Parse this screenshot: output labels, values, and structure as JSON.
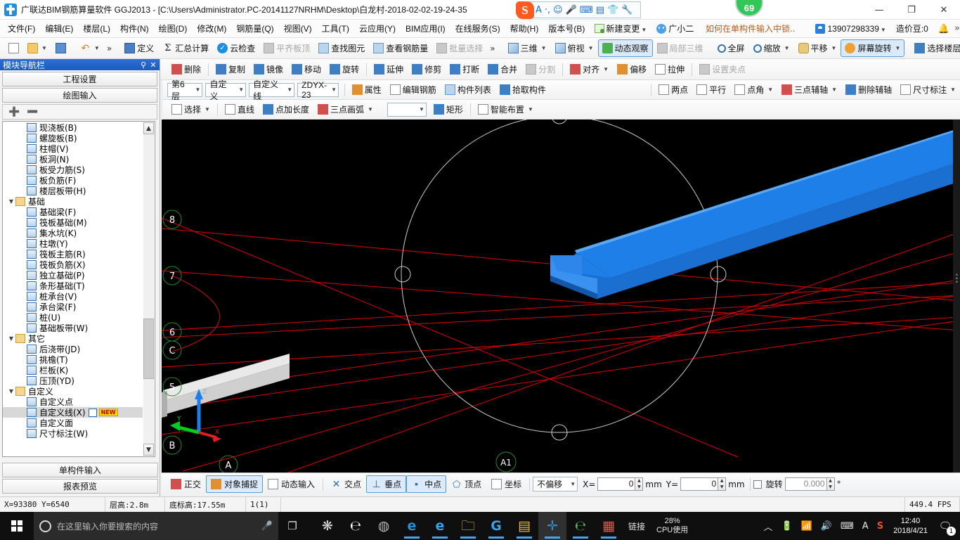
{
  "titlebar": {
    "title": "广联达BIM钢筋算量软件 GGJ2013 - [C:\\Users\\Administrator.PC-20141127NRHM\\Desktop\\白龙村-2018-02-02-19-24-35",
    "logo_name": "ggj-logo",
    "sogou_icons": [
      "sogou-s-icon",
      "A",
      "·,",
      "☺",
      "🎤",
      "⌨",
      "📇",
      "👕",
      "🔧"
    ],
    "minimize": "—",
    "maximize": "❐",
    "close": "✕",
    "badge": "69"
  },
  "menubar": {
    "items": [
      "文件(F)",
      "编辑(E)",
      "楼层(L)",
      "构件(N)",
      "绘图(D)",
      "修改(M)",
      "钢筋量(Q)",
      "视图(V)",
      "工具(T)",
      "云应用(Y)",
      "BIM应用(I)",
      "在线服务(S)",
      "帮助(H)",
      "版本号(B)"
    ],
    "new_change": "新建变更",
    "assistant": "广小二",
    "tip": "如何在单构件输入中锁..",
    "phone": "13907298339",
    "beans": "造价豆:0",
    "more": "»"
  },
  "toolbar1": {
    "left": [
      {
        "label": "",
        "icon": "new-file-icon"
      },
      {
        "label": "",
        "icon": "open-folder-icon"
      },
      {
        "label": "",
        "icon": "save-icon"
      },
      {
        "label": "",
        "icon": "undo-icon"
      }
    ],
    "chev": "»",
    "items": [
      {
        "label": "定义",
        "icon": "define-icon",
        "state": "normal"
      },
      {
        "label": "汇总计算",
        "icon": "sigma-icon",
        "state": "normal"
      },
      {
        "label": "云检查",
        "icon": "cloud-check-icon",
        "state": "normal"
      },
      {
        "label": "平齐板顶",
        "icon": "align-slab-icon",
        "state": "disabled"
      },
      {
        "label": "查找图元",
        "icon": "find-element-icon",
        "state": "normal"
      },
      {
        "label": "查看钢筋量",
        "icon": "view-rebar-icon",
        "state": "normal"
      },
      {
        "label": "批量选择",
        "icon": "batch-select-icon",
        "state": "disabled"
      }
    ],
    "right_chev": "»",
    "view_items": [
      {
        "label": "三维",
        "icon": "cube-icon",
        "state": "normal",
        "caret": true
      },
      {
        "label": "俯视",
        "icon": "topview-icon",
        "state": "normal",
        "caret": true
      },
      {
        "label": "动态观察",
        "icon": "orbit-icon",
        "state": "active"
      },
      {
        "label": "局部三维",
        "icon": "partial3d-icon",
        "state": "disabled"
      },
      {
        "label": "全屏",
        "icon": "fullscreen-icon",
        "state": "normal"
      },
      {
        "label": "缩放",
        "icon": "zoom-icon",
        "state": "normal",
        "caret": true
      },
      {
        "label": "平移",
        "icon": "pan-icon",
        "state": "normal",
        "caret": true
      },
      {
        "label": "屏幕旋转",
        "icon": "screen-rotate-icon",
        "state": "active",
        "caret": true
      },
      {
        "label": "选择楼层",
        "icon": "select-floor-icon",
        "state": "normal"
      }
    ],
    "far_chev": "»"
  },
  "toolbar2": {
    "items": [
      {
        "label": "删除",
        "icon": "delete-icon",
        "state": "normal"
      },
      {
        "label": "复制",
        "icon": "copy-icon",
        "state": "normal"
      },
      {
        "label": "镜像",
        "icon": "mirror-icon",
        "state": "normal"
      },
      {
        "label": "移动",
        "icon": "move-icon",
        "state": "normal"
      },
      {
        "label": "旋转",
        "icon": "rotate-icon",
        "state": "normal"
      },
      {
        "label": "延伸",
        "icon": "extend-icon",
        "state": "normal"
      },
      {
        "label": "修剪",
        "icon": "trim-icon",
        "state": "normal"
      },
      {
        "label": "打断",
        "icon": "break-icon",
        "state": "normal"
      },
      {
        "label": "合并",
        "icon": "merge-icon",
        "state": "normal"
      },
      {
        "label": "分割",
        "icon": "split-icon",
        "state": "disabled"
      },
      {
        "label": "对齐",
        "icon": "align-icon",
        "state": "normal",
        "caret": true
      },
      {
        "label": "偏移",
        "icon": "offset-icon",
        "state": "normal"
      },
      {
        "label": "拉伸",
        "icon": "stretch-icon",
        "state": "normal"
      },
      {
        "label": "设置夹点",
        "icon": "set-grip-icon",
        "state": "disabled"
      }
    ]
  },
  "toolbar3": {
    "combos": [
      {
        "name": "floor-combo",
        "value": "第6层"
      },
      {
        "name": "category-combo",
        "value": "自定义"
      },
      {
        "name": "type-combo",
        "value": "自定义线"
      },
      {
        "name": "element-combo",
        "value": "ZDYX-23"
      }
    ],
    "items": [
      {
        "label": "属性",
        "icon": "properties-icon"
      },
      {
        "label": "编辑钢筋",
        "icon": "edit-rebar-icon"
      },
      {
        "label": "构件列表",
        "icon": "element-list-icon"
      },
      {
        "label": "拾取构件",
        "icon": "pick-element-icon"
      }
    ],
    "axis_items": [
      {
        "label": "两点",
        "icon": "two-point-icon"
      },
      {
        "label": "平行",
        "icon": "parallel-icon"
      },
      {
        "label": "点角",
        "icon": "point-angle-icon",
        "caret": true
      },
      {
        "label": "三点辅轴",
        "icon": "three-point-axis-icon",
        "caret": true
      },
      {
        "label": "删除辅轴",
        "icon": "delete-axis-icon"
      },
      {
        "label": "尺寸标注",
        "icon": "dimension-icon",
        "caret": true
      }
    ]
  },
  "toolbar4": {
    "items": [
      {
        "label": "选择",
        "icon": "cursor-icon",
        "caret": true
      },
      {
        "label": "直线",
        "icon": "line-icon"
      },
      {
        "label": "点加长度",
        "icon": "point-length-icon"
      },
      {
        "label": "三点画弧",
        "icon": "three-point-arc-icon",
        "caret": true
      }
    ],
    "blank_combo": "",
    "rect": {
      "label": "矩形",
      "icon": "rectangle-icon"
    },
    "smart": {
      "label": "智能布置",
      "icon": "smart-layout-icon",
      "caret": true
    }
  },
  "leftpanel": {
    "title": "模块导航栏",
    "pin": "⚲",
    "close": "✕",
    "buttons": [
      "工程设置",
      "绘图输入"
    ],
    "expand_all": "expand-all-icon",
    "collapse_all": "collapse-all-icon",
    "footer_buttons": [
      "单构件输入",
      "报表预览"
    ],
    "tree": [
      {
        "label": "现浇板(B)",
        "depth": 2,
        "type": "leaf"
      },
      {
        "label": "螺旋板(B)",
        "depth": 2,
        "type": "leaf"
      },
      {
        "label": "柱帽(V)",
        "depth": 2,
        "type": "leaf"
      },
      {
        "label": "板洞(N)",
        "depth": 2,
        "type": "leaf"
      },
      {
        "label": "板受力筋(S)",
        "depth": 2,
        "type": "leaf"
      },
      {
        "label": "板负筋(F)",
        "depth": 2,
        "type": "leaf"
      },
      {
        "label": "楼层板带(H)",
        "depth": 2,
        "type": "leaf"
      },
      {
        "label": "基础",
        "depth": 1,
        "type": "folder",
        "expanded": true
      },
      {
        "label": "基础梁(F)",
        "depth": 2,
        "type": "leaf"
      },
      {
        "label": "筏板基础(M)",
        "depth": 2,
        "type": "leaf"
      },
      {
        "label": "集水坑(K)",
        "depth": 2,
        "type": "leaf"
      },
      {
        "label": "柱墩(Y)",
        "depth": 2,
        "type": "leaf"
      },
      {
        "label": "筏板主筋(R)",
        "depth": 2,
        "type": "leaf"
      },
      {
        "label": "筏板负筋(X)",
        "depth": 2,
        "type": "leaf"
      },
      {
        "label": "独立基础(P)",
        "depth": 2,
        "type": "leaf"
      },
      {
        "label": "条形基础(T)",
        "depth": 2,
        "type": "leaf"
      },
      {
        "label": "桩承台(V)",
        "depth": 2,
        "type": "leaf"
      },
      {
        "label": "承台梁(F)",
        "depth": 2,
        "type": "leaf"
      },
      {
        "label": "桩(U)",
        "depth": 2,
        "type": "leaf"
      },
      {
        "label": "基础板带(W)",
        "depth": 2,
        "type": "leaf"
      },
      {
        "label": "其它",
        "depth": 1,
        "type": "folder",
        "expanded": true
      },
      {
        "label": "后浇带(JD)",
        "depth": 2,
        "type": "leaf"
      },
      {
        "label": "挑檐(T)",
        "depth": 2,
        "type": "leaf"
      },
      {
        "label": "栏板(K)",
        "depth": 2,
        "type": "leaf"
      },
      {
        "label": "压顶(YD)",
        "depth": 2,
        "type": "leaf"
      },
      {
        "label": "自定义",
        "depth": 1,
        "type": "folder",
        "expanded": true
      },
      {
        "label": "自定义点",
        "depth": 2,
        "type": "leaf"
      },
      {
        "label": "自定义线(X)",
        "depth": 2,
        "type": "leaf",
        "selected": true,
        "new": true
      },
      {
        "label": "自定义面",
        "depth": 2,
        "type": "leaf"
      },
      {
        "label": "尺寸标注(W)",
        "depth": 2,
        "type": "leaf"
      }
    ],
    "scroll_up": "▲",
    "scroll_down": "▼"
  },
  "viewport": {
    "axis_labels_left": [
      "8",
      "7",
      "6",
      "C",
      "5",
      "B"
    ],
    "axis_labels_bottom": [
      "A",
      "A1"
    ],
    "axis_triad": {
      "x": "X",
      "y": "Y",
      "z": "Z"
    }
  },
  "snapbar": {
    "toggles": [
      {
        "label": "正交",
        "icon": "ortho-icon",
        "on": false
      },
      {
        "label": "对象捕捉",
        "icon": "object-snap-icon",
        "on": true
      },
      {
        "label": "动态输入",
        "icon": "dynamic-input-icon",
        "on": false
      }
    ],
    "snaps": [
      {
        "label": "交点",
        "icon": "intersection-icon",
        "on": false
      },
      {
        "label": "垂点",
        "icon": "perpendicular-icon",
        "on": true
      },
      {
        "label": "中点",
        "icon": "midpoint-icon",
        "on": true
      },
      {
        "label": "顶点",
        "icon": "vertex-icon",
        "on": false
      },
      {
        "label": "坐标",
        "icon": "coordinate-icon",
        "on": false
      }
    ],
    "offset_combo": "不偏移",
    "x_label": "X=",
    "x_value": "0",
    "x_unit": "mm",
    "y_label": "Y=",
    "y_value": "0",
    "y_unit": "mm",
    "rotate_label": "旋转",
    "rotate_value": "0.000",
    "rotate_unit": "°"
  },
  "statusbar": {
    "coords": "X=93380 Y=6540",
    "floor_height": "层高:2.8m",
    "base_elev": "底标高:17.55m",
    "counter": "1(1)",
    "fps": "449.4 FPS"
  },
  "taskbar": {
    "search_placeholder": "在这里输入你要搜索的内容",
    "cortana_icon": "cortana-icon",
    "mic_icon": "microphone-icon",
    "taskview_icon": "task-view-icon",
    "apps": [
      {
        "name": "app-windmill",
        "glyph": "❋",
        "color": "#dcdcdc",
        "running": false
      },
      {
        "name": "app-edge-old",
        "glyph": "℮",
        "color": "#ffffff",
        "running": false
      },
      {
        "name": "app-spiral",
        "glyph": "◍",
        "color": "#cccccc",
        "running": false
      },
      {
        "name": "app-edge",
        "glyph": "e",
        "color": "#2b8fd8",
        "running": true
      },
      {
        "name": "app-ie",
        "glyph": "e",
        "color": "#38a0e8",
        "running": true
      },
      {
        "name": "app-explorer",
        "glyph": "🗀",
        "color": "#f2c254",
        "running": true
      },
      {
        "name": "app-360",
        "glyph": "G",
        "color": "#3aa0e8",
        "running": true
      },
      {
        "name": "app-notes",
        "glyph": "▤",
        "color": "#f0b93c",
        "running": true
      },
      {
        "name": "app-ggj",
        "glyph": "✛",
        "color": "#2b8fd8",
        "running": true,
        "active": true
      },
      {
        "name": "app-browser-green",
        "glyph": "℮",
        "color": "#5cb85c",
        "running": true
      },
      {
        "name": "app-calendar",
        "glyph": "▦",
        "color": "#e05a4a",
        "running": true
      }
    ],
    "link_label": "链接",
    "cpu_percent": "28%",
    "cpu_label": "CPU使用",
    "tray_chevron": "︿",
    "tray_icons": [
      "battery-icon",
      "wifi-icon",
      "volume-icon",
      "keyboard-icon",
      "lang-A-icon",
      "sogou-icon"
    ],
    "time": "12:40",
    "date": "2018/4/21",
    "notif_badge": "1"
  }
}
